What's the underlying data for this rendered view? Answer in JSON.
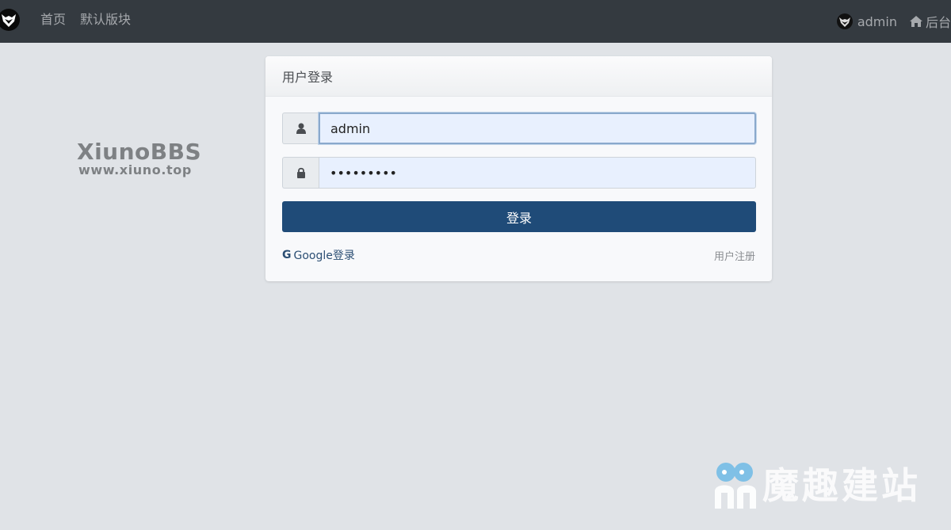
{
  "nav": {
    "home": "首页",
    "default_forum": "默认版块",
    "username": "admin",
    "admin_panel": "后台"
  },
  "brand": {
    "title": "XiunoBBS",
    "url": "www.xiuno.top"
  },
  "login": {
    "header": "用户登录",
    "username_value": "admin",
    "password_value": "•••••••••",
    "submit_label": "登录",
    "google_label": "Google登录",
    "register_label": "用户注册"
  },
  "watermark": {
    "text": "魔趣建站"
  },
  "colors": {
    "navbar": "#343a40",
    "background": "#e0e3e7",
    "primary_button": "#1f4b78",
    "autofill": "#e8f0fe"
  }
}
